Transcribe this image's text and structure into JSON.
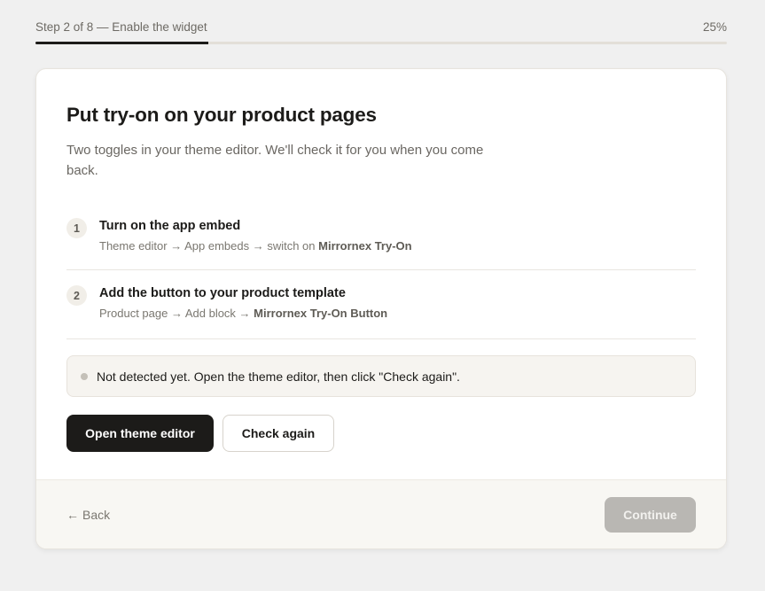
{
  "progress": {
    "label": "Step 2 of 8 — Enable the widget",
    "percent_label": "25%",
    "fraction": 0.25
  },
  "card": {
    "title": "Put try-on on your product pages",
    "subtitle": "Two toggles in your theme editor. We'll check it for you when you come back.",
    "steps": [
      {
        "number": "1",
        "title": "Turn on the app embed",
        "desc_prefix": "Theme editor → App embeds → switch on ",
        "desc_strong": "Mirrornex Try-On"
      },
      {
        "number": "2",
        "title": "Add the button to your product template",
        "desc_prefix": "Product page → Add block → ",
        "desc_strong": "Mirrornex Try-On Button"
      }
    ],
    "status": {
      "text": "Not detected yet. Open the theme editor, then click \"Check again\"."
    },
    "actions": {
      "primary_label": "Open theme editor",
      "secondary_label": "Check again"
    }
  },
  "footer": {
    "back_arrow": "←",
    "back_label": "Back",
    "continue_label": "Continue"
  },
  "colors": {
    "accent": "#1c1b19",
    "status_dot": "#c4c0b8",
    "continue_disabled": "#b9b7b3"
  },
  "icons": {
    "back": "arrow-left-icon",
    "status": "status-dot-icon"
  }
}
